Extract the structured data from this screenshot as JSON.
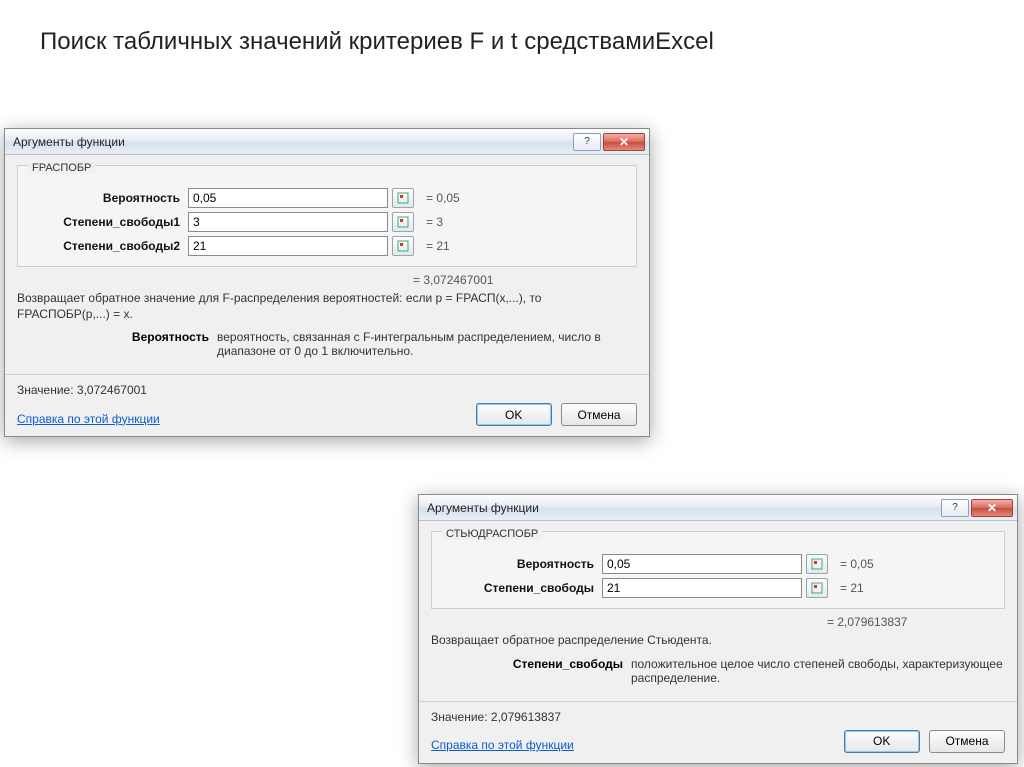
{
  "page": {
    "title": "Поиск табличных значений критериев F и t средствамиExcel"
  },
  "dialog1": {
    "title": "Аргументы функции",
    "function_name": "FРАСПОБР",
    "args": [
      {
        "label": "Вероятность",
        "value": "0,05",
        "eval": "= 0,05"
      },
      {
        "label": "Степени_свободы1",
        "value": "3",
        "eval": "= 3"
      },
      {
        "label": "Степени_свободы2",
        "value": "21",
        "eval": "= 21"
      }
    ],
    "result_inline": "= 3,072467001",
    "description": "Возвращает обратное значение для F-распределения вероятностей: если p = FРАСП(x,...), то FРАСПОБР(p,...) = x.",
    "param_help_label": "Вероятность",
    "param_help_text": "вероятность, связанная с F-интегральным распределением, число в диапазоне от 0 до 1 включительно.",
    "value_label": "Значение:",
    "value": "3,072467001",
    "help_link": "Справка по этой функции",
    "ok": "OK",
    "cancel": "Отмена",
    "help_icon": "?"
  },
  "dialog2": {
    "title": "Аргументы функции",
    "function_name": "СТЬЮДРАСПОБР",
    "args": [
      {
        "label": "Вероятность",
        "value": "0,05",
        "eval": "= 0,05"
      },
      {
        "label": "Степени_свободы",
        "value": "21",
        "eval": "= 21"
      }
    ],
    "result_inline": "= 2,079613837",
    "description": "Возвращает обратное распределение Стьюдента.",
    "param_help_label": "Степени_свободы",
    "param_help_text": "положительное целое число степеней свободы, характеризующее распределение.",
    "value_label": "Значение:",
    "value": "2,079613837",
    "help_link": "Справка по этой функции",
    "ok": "OK",
    "cancel": "Отмена",
    "help_icon": "?"
  }
}
